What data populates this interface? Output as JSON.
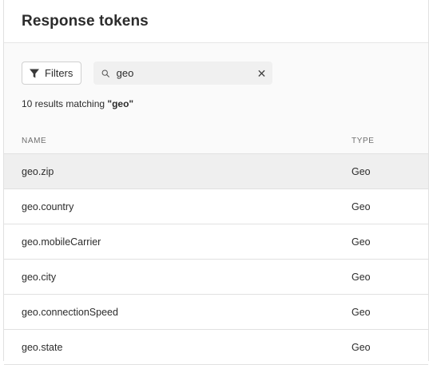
{
  "panel": {
    "title": "Response tokens"
  },
  "toolbar": {
    "filters_label": "Filters",
    "search_value": "geo",
    "search_placeholder": "Search"
  },
  "results": {
    "prefix": "10 results matching",
    "query": "\"geo\""
  },
  "table": {
    "columns": [
      "NAME",
      "TYPE"
    ],
    "rows": [
      {
        "name": "geo.zip",
        "type": "Geo",
        "selected": true
      },
      {
        "name": "geo.country",
        "type": "Geo"
      },
      {
        "name": "geo.mobileCarrier",
        "type": "Geo"
      },
      {
        "name": "geo.city",
        "type": "Geo"
      },
      {
        "name": "geo.connectionSpeed",
        "type": "Geo"
      },
      {
        "name": "geo.state",
        "type": "Geo"
      }
    ]
  }
}
